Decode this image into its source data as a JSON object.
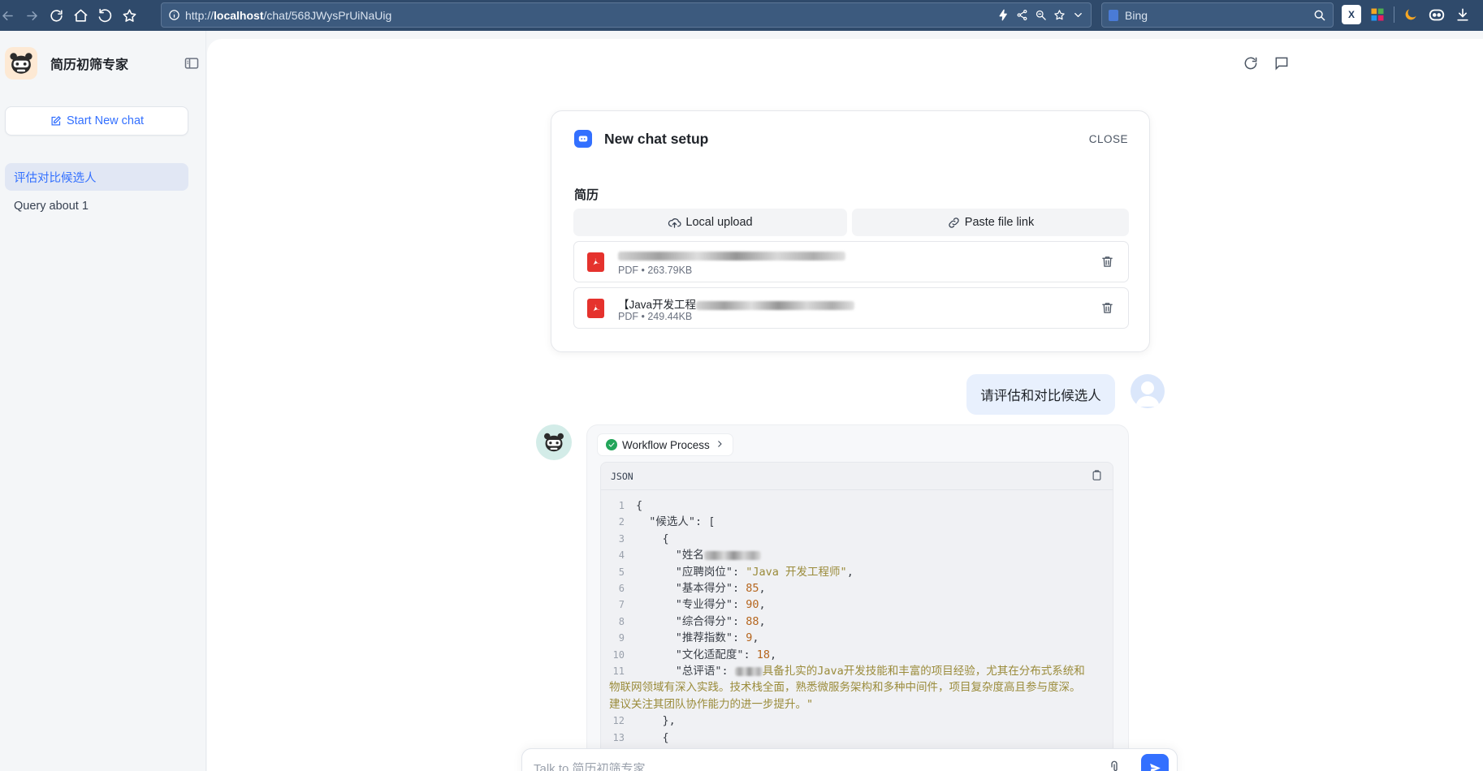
{
  "browser": {
    "url_prefix": "http://",
    "url_host": "localhost",
    "url_path": "/chat/568JWysPrUiNaUig",
    "search_engine": "Bing"
  },
  "sidebar": {
    "app_name": "简历初筛专家",
    "new_chat_label": "Start New chat",
    "history": [
      {
        "label": "评估对比候选人",
        "active": true
      },
      {
        "label": "Query about 1",
        "active": false
      }
    ]
  },
  "setup": {
    "title": "New chat setup",
    "close_label": "CLOSE",
    "section_label": "简历",
    "local_upload_label": "Local upload",
    "paste_link_label": "Paste file link",
    "files": [
      {
        "name_prefix": "",
        "type": "PDF",
        "size": "263.79KB"
      },
      {
        "name_prefix": "【Java开发工程",
        "type": "PDF",
        "size": "249.44KB"
      }
    ],
    "meta_separator": "•"
  },
  "chat": {
    "user_message": "请评估和对比候选人",
    "workflow_label": "Workflow Process",
    "code_lang": "JSON",
    "code_lines": [
      {
        "n": "1",
        "t": "{"
      },
      {
        "n": "2",
        "t": "  \"候选人\": ["
      },
      {
        "n": "3",
        "t": "    {"
      },
      {
        "n": "4",
        "t": "      \"姓名"
      },
      {
        "n": "5",
        "k": "      \"应聘岗位\": ",
        "v": "\"Java 开发工程师\"",
        "tail": ","
      },
      {
        "n": "6",
        "k": "      \"基本得分\": ",
        "num": "85",
        "tail": ","
      },
      {
        "n": "7",
        "k": "      \"专业得分\": ",
        "num": "90",
        "tail": ","
      },
      {
        "n": "8",
        "k": "      \"综合得分\": ",
        "num": "88",
        "tail": ","
      },
      {
        "n": "9",
        "k": "      \"推荐指数\": ",
        "num": "9",
        "tail": ","
      },
      {
        "n": "10",
        "k": "      \"文化适配度\": ",
        "num": "18",
        "tail": ","
      },
      {
        "n": "11",
        "k": "      \"总评语\": ",
        "v": "具备扎实的Java开发技能和丰富的项目经验，尤其在分布式系统和"
      }
    ],
    "wrap_line_1": "物联网领域有深入实践。技术栈全面，熟悉微服务架构和多种中间件，项目复杂度高且参与度深。",
    "wrap_line_2": "建议关注其团队协作能力的进一步提升。\"",
    "code_lines_tail": [
      {
        "n": "12",
        "t": "    },"
      },
      {
        "n": "13",
        "t": "    {"
      }
    ]
  },
  "input": {
    "placeholder": "Talk to 简历初筛专家"
  },
  "colors": {
    "accent": "#3370ff",
    "browser_bar": "#2f4a6b",
    "pdf_red": "#e5322d",
    "success": "#22a559"
  }
}
